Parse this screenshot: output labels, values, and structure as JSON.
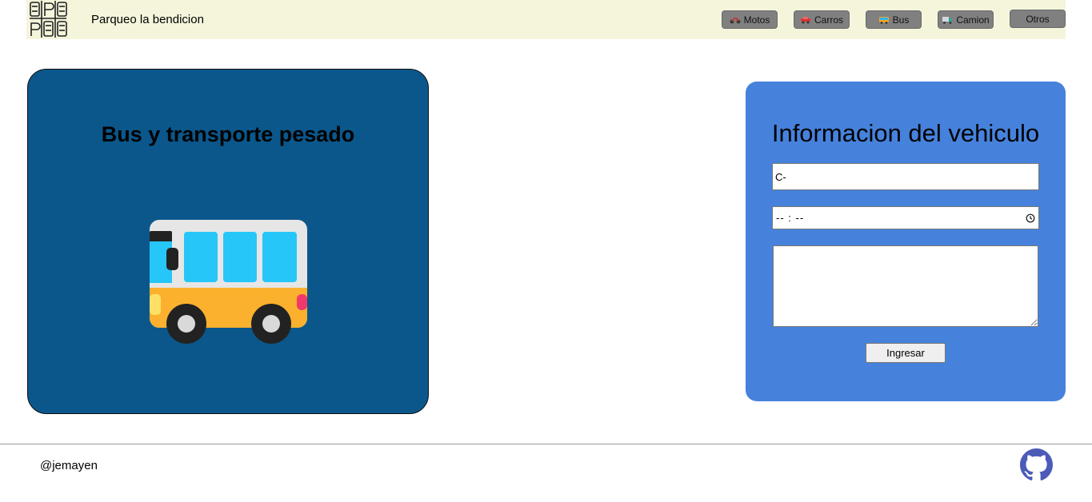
{
  "header": {
    "brand": "Parqueo la bendicion",
    "logo_icon": "parking-grid-logo",
    "nav": [
      {
        "label": "Motos",
        "icon": "motorcycle-icon"
      },
      {
        "label": "Carros",
        "icon": "car-icon"
      },
      {
        "label": "Bus",
        "icon": "bus-icon"
      },
      {
        "label": "Camion",
        "icon": "truck-icon"
      },
      {
        "label": "Otros",
        "icon": ""
      }
    ]
  },
  "card": {
    "title": "Bus y transporte pesado",
    "illustration": "bus-illustration",
    "background": "#0b578b"
  },
  "form": {
    "title": "Informacion del vehiculo",
    "plate_value": "C-",
    "time_value": "-- : --",
    "notes_value": "",
    "submit_label": "Ingresar",
    "background": "#4682dc"
  },
  "footer": {
    "handle": "@jemayen",
    "link_icon": "github-icon"
  }
}
